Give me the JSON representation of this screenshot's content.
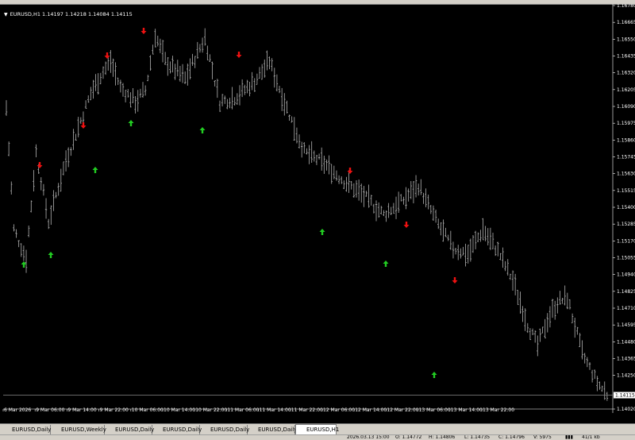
{
  "chart": {
    "symbol_line": "EURUSD,H1  1.14197 1.14218 1.14084 1.14115",
    "current_price": "1.14115",
    "price_axis": {
      "min": 1.1402,
      "max": 1.1678,
      "ticks": [
        "1.16780",
        "1.16665",
        "1.16550",
        "1.16435",
        "1.16320",
        "1.16205",
        "1.16090",
        "1.15975",
        "1.15860",
        "1.15745",
        "1.15630",
        "1.15515",
        "1.15400",
        "1.15285",
        "1.15170",
        "1.15055",
        "1.14940",
        "1.14825",
        "1.14710",
        "1.14595",
        "1.14480",
        "1.14365",
        "1.14250",
        "1.14115",
        "1.14020"
      ]
    },
    "time_axis": [
      "6 Mar 2026",
      "9 Mar 06:00",
      "9 Mar 14:00",
      "9 Mar 22:00",
      "10 Mar 06:00",
      "10 Mar 14:00",
      "10 Mar 22:00",
      "11 Mar 06:00",
      "11 Mar 14:00",
      "11 Mar 22:00",
      "12 Mar 06:00",
      "12 Mar 14:00",
      "12 Mar 22:00",
      "13 Mar 06:00",
      "13 Mar 14:00",
      "13 Mar 22:00"
    ],
    "colors": {
      "background": "#000000",
      "bars": "#b4b4b4",
      "up_arrow": "#22cc22",
      "down_arrow": "#ee1111",
      "price_line": "#8a8a8a"
    }
  },
  "tabs": [
    {
      "label": "EURUSD,Daily",
      "active": false
    },
    {
      "label": "EURUSD,Weekly",
      "active": false
    },
    {
      "label": "EURUSD,Daily",
      "active": false
    },
    {
      "label": "EURUSD,Daily",
      "active": false
    },
    {
      "label": "EURUSD,Daily",
      "active": false
    },
    {
      "label": "EURUSD,Daily",
      "active": false
    },
    {
      "label": "EURUSD,H1",
      "active": true
    }
  ],
  "status": {
    "date": "2026.03.13 15:00",
    "open": "O: 1.14772",
    "high": "H: 1.14806",
    "low": "L: 1.14735",
    "close": "C: 1.14796",
    "volume": "V: 5975",
    "connection": "41/1 kb"
  }
}
